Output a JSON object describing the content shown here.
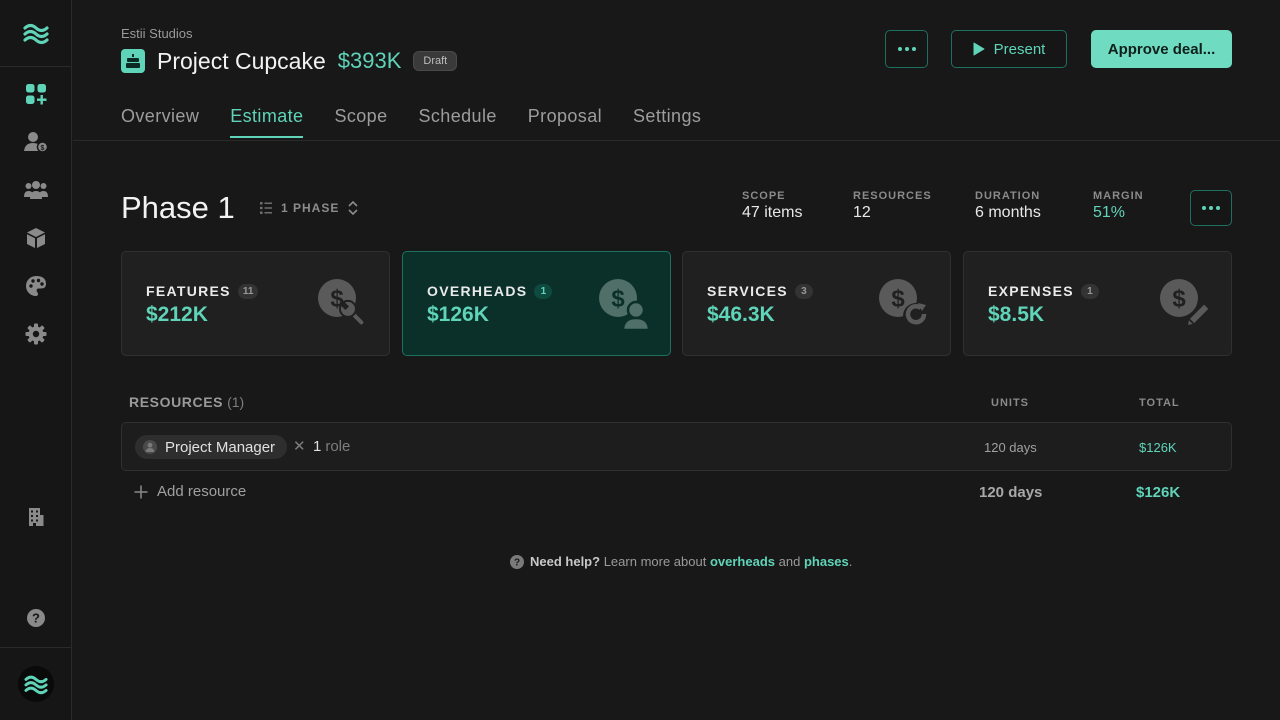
{
  "org": "Estii Studios",
  "project": {
    "title": "Project Cupcake",
    "amount": "$393K",
    "status": "Draft"
  },
  "actions": {
    "more_icon": "ellipsis-icon",
    "present": "Present",
    "approve": "Approve deal..."
  },
  "tabs": [
    {
      "label": "Overview",
      "active": false
    },
    {
      "label": "Estimate",
      "active": true
    },
    {
      "label": "Scope",
      "active": false
    },
    {
      "label": "Schedule",
      "active": false
    },
    {
      "label": "Proposal",
      "active": false
    },
    {
      "label": "Settings",
      "active": false
    }
  ],
  "sidebar": {
    "items": [
      "dashboard-add-icon",
      "client-billing-icon",
      "team-icon",
      "package-icon",
      "palette-icon",
      "settings-icon"
    ],
    "bottom": [
      "building-icon",
      "moon-icon",
      "help-icon"
    ]
  },
  "phase": {
    "title": "Phase 1",
    "selector": "1 PHASE",
    "stats": {
      "scope": {
        "label": "SCOPE",
        "value": "47 items"
      },
      "resources": {
        "label": "RESOURCES",
        "value": "12"
      },
      "duration": {
        "label": "DURATION",
        "value": "6 months"
      },
      "margin": {
        "label": "MARGIN",
        "value": "51%"
      }
    }
  },
  "cards": [
    {
      "label": "FEATURES",
      "count": "11",
      "value": "$212K",
      "icon": "dollar-wrench-icon",
      "active": false
    },
    {
      "label": "OVERHEADS",
      "count": "1",
      "value": "$126K",
      "icon": "dollar-person-icon",
      "active": true
    },
    {
      "label": "SERVICES",
      "count": "3",
      "value": "$46.3K",
      "icon": "dollar-refresh-icon",
      "active": false
    },
    {
      "label": "EXPENSES",
      "count": "1",
      "value": "$8.5K",
      "icon": "dollar-pencil-icon",
      "active": false
    }
  ],
  "resources": {
    "title": "RESOURCES",
    "count": "(1)",
    "col_units": "UNITS",
    "col_total": "TOTAL",
    "rows": [
      {
        "name": "Project Manager",
        "times": "✕",
        "qty": "1",
        "unit": "role",
        "units": "120 days",
        "total": "$126K"
      }
    ],
    "add_label": "Add resource",
    "sum_units": "120 days",
    "sum_total": "$126K"
  },
  "help": {
    "lead": "Need help?",
    "text": "Learn more about",
    "link1": "overheads",
    "and": "and",
    "link2": "phases",
    "end": "."
  },
  "colors": {
    "accent": "#5fd4b8",
    "bg": "#181818",
    "active_card": "#0b302a"
  }
}
